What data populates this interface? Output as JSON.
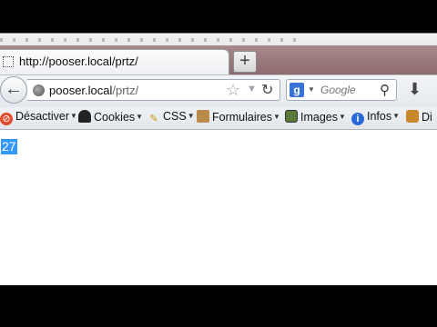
{
  "tab": {
    "title": "http://pooser.local/prtz/",
    "new_tab_label": "+"
  },
  "navbar": {
    "url_host": "pooser.local",
    "url_path": "/prtz/",
    "search_placeholder": "Google"
  },
  "bookmarks": [
    {
      "label": "Désactiver",
      "icon": "disable-icon"
    },
    {
      "label": "Cookies",
      "icon": "cookies-icon"
    },
    {
      "label": "CSS",
      "icon": "css-pencil-icon"
    },
    {
      "label": "Formulaires",
      "icon": "forms-clipboard-icon"
    },
    {
      "label": "Images",
      "icon": "images-icon"
    },
    {
      "label": "Infos",
      "icon": "info-icon"
    },
    {
      "label": "Di",
      "icon": "divers-icon"
    }
  ],
  "page": {
    "selected_text": "27"
  },
  "colors": {
    "selection": "#3399ff",
    "tabstrip": "#8e6b6e"
  }
}
